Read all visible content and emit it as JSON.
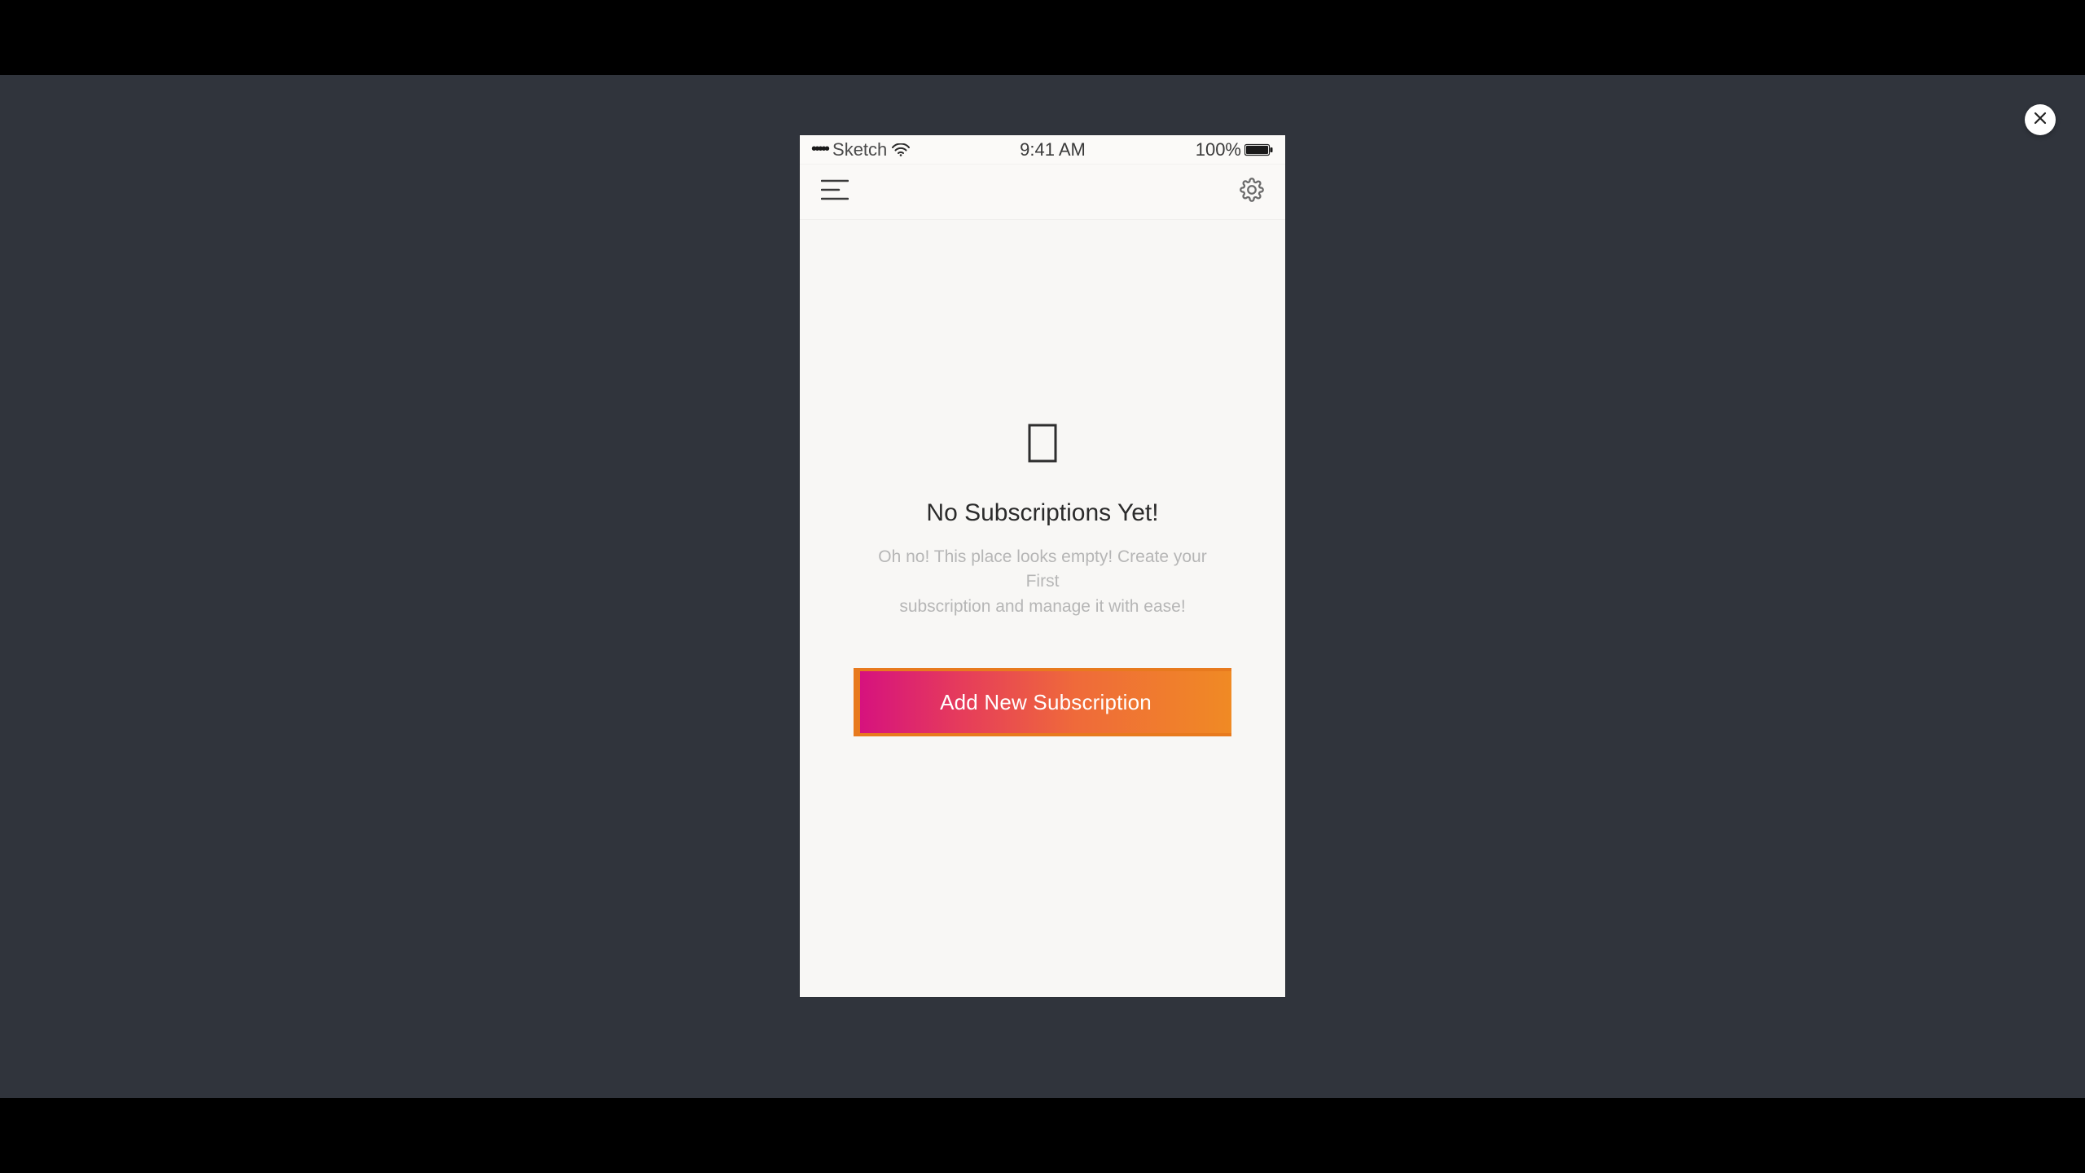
{
  "lightbox": {
    "close_label": "×"
  },
  "statusBar": {
    "carrier": "Sketch",
    "time": "9:41 AM",
    "batteryText": "100%"
  },
  "content": {
    "title": "No Subscriptions Yet!",
    "subtitle_line1": "Oh no! This place looks empty! Create your First",
    "subtitle_line2": "subscription and manage it with ease!",
    "cta_label": "Add New Subscription"
  }
}
